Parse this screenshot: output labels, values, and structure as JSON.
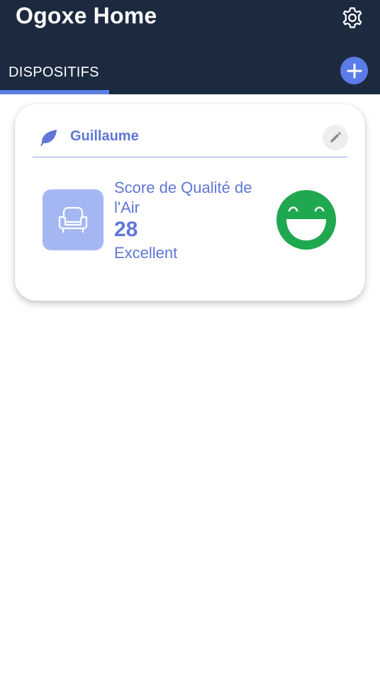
{
  "app": {
    "title": "Ogoxe Home"
  },
  "header": {
    "settings_icon": "gear-icon",
    "tabs": [
      {
        "label": "DISPOSITIFS",
        "active": true
      }
    ],
    "add_icon": "plus-icon"
  },
  "device_card": {
    "name": "Guillaume",
    "name_icon": "leaf-icon",
    "edit_icon": "pencil-icon",
    "room_icon": "armchair-icon",
    "score_label": "Score de Qualité de l'Air",
    "score_value": "28",
    "score_status": "Excellent",
    "status_icon": "laughing-face-icon"
  },
  "colors": {
    "appbar": "#1c2a40",
    "accent": "#5b7be8",
    "text_accent": "#5f77d8",
    "room_tile": "#a5b7f2",
    "status_good": "#1fa84f"
  }
}
